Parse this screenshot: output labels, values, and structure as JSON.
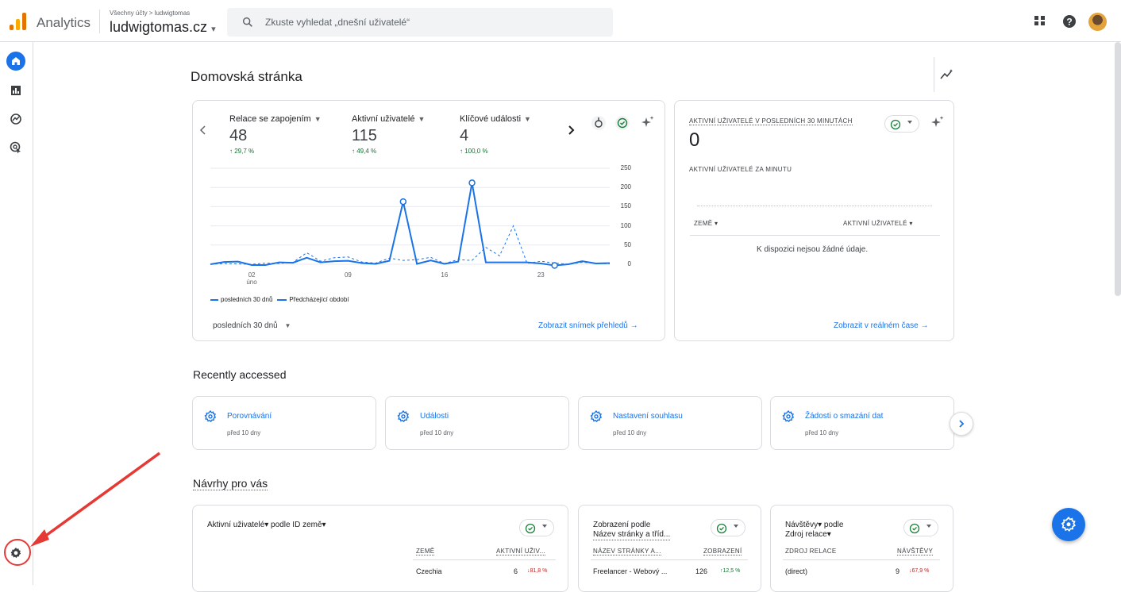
{
  "app": {
    "name": "Analytics"
  },
  "header": {
    "breadcrumb": "Všechny účty > ludwigtomas",
    "property": "ludwigtomas.cz",
    "search_placeholder": "Zkuste vyhledat „dnešní uživatelé“"
  },
  "page": {
    "title": "Domovská stránka"
  },
  "overview": {
    "metrics": [
      {
        "label": "Relace se zapojením",
        "value": "48",
        "delta": "↑ 29,7 %"
      },
      {
        "label": "Aktivní uživatelé",
        "value": "115",
        "delta": "↑ 49,4 %"
      },
      {
        "label": "Klíčové události",
        "value": "4",
        "delta": "↑ 100,0 %"
      }
    ],
    "date_range": "posledních 30 dnů",
    "link": "Zobrazit snímek přehledů →",
    "legend_current": "posledních 30 dnů",
    "legend_previous": "Předcházející období"
  },
  "chart_data": {
    "type": "line",
    "y_ticks": [
      "250",
      "200",
      "150",
      "100",
      "50",
      "0"
    ],
    "ylim": [
      0,
      250
    ],
    "x_tick_labels": [
      {
        "label": "02",
        "sub": "úno",
        "index": 3
      },
      {
        "label": "09",
        "sub": "",
        "index": 10
      },
      {
        "label": "16",
        "sub": "",
        "index": 17
      },
      {
        "label": "23",
        "sub": "",
        "index": 24
      }
    ],
    "series": [
      {
        "name": "posledních 30 dnů",
        "style": "solid",
        "color": "#1a73e8",
        "values": [
          0,
          6,
          7,
          -2,
          -2,
          5,
          4,
          17,
          5,
          8,
          9,
          3,
          1,
          9,
          163,
          1,
          10,
          1,
          7,
          212,
          5,
          5,
          5,
          5,
          2,
          -3,
          0,
          8,
          2,
          3
        ]
      },
      {
        "name": "Předcházející období",
        "style": "dashed",
        "color": "#1a73e8",
        "values": [
          0,
          2,
          1,
          0,
          3,
          2,
          5,
          30,
          8,
          17,
          19,
          6,
          3,
          16,
          10,
          12,
          18,
          2,
          12,
          10,
          44,
          22,
          100,
          2,
          8,
          3,
          0,
          5,
          3,
          1
        ]
      }
    ],
    "highlight_indices": [
      14,
      19,
      25
    ]
  },
  "realtime": {
    "title": "AKTIVNÍ UŽIVATELÉ V POSLEDNÍCH 30 MINUTÁCH",
    "value": "0",
    "per_minute": "AKTIVNÍ UŽIVATELÉ ZA MINUTU",
    "col_country": "ZEMĚ",
    "col_users": "AKTIVNÍ UŽIVATELÉ",
    "empty": "K dispozici nejsou žádné údaje.",
    "link": "Zobrazit v reálném čase →"
  },
  "recent": {
    "heading": "Recently accessed",
    "items": [
      {
        "title": "Porovnávání",
        "sub": "před 10 dny"
      },
      {
        "title": "Události",
        "sub": "před 10 dny"
      },
      {
        "title": "Nastavení souhlasu",
        "sub": "před 10 dny"
      },
      {
        "title": "Žádosti o smazání dat",
        "sub": "před 10 dny"
      }
    ]
  },
  "suggestions": {
    "heading": "Návrhy pro vás",
    "cards": [
      {
        "title": "Aktivní uživatelé▾ podle ID země▾",
        "col1": "ZEMĚ",
        "col2": "AKTIVNÍ UŽIV...",
        "row": {
          "name": "Czechia",
          "value": "6",
          "delta": "↓81,8 %"
        }
      },
      {
        "title_l1": "Zobrazení podle",
        "title_l2": "Název stránky a tříd...",
        "col1": "NÁZEV STRÁNKY A...",
        "col2": "ZOBRAZENÍ",
        "row": {
          "name": "Freelancer - Webový ...",
          "value": "126",
          "delta": "↑12,5 %"
        }
      },
      {
        "title_l1": "Návštěvy▾ podle",
        "title_l2": "Zdroj relace▾",
        "col1": "ZDROJ RELACE",
        "col2": "NÁVŠTĚVY",
        "row": {
          "name": "(direct)",
          "value": "9",
          "delta": "↓67,9 %"
        }
      }
    ]
  }
}
